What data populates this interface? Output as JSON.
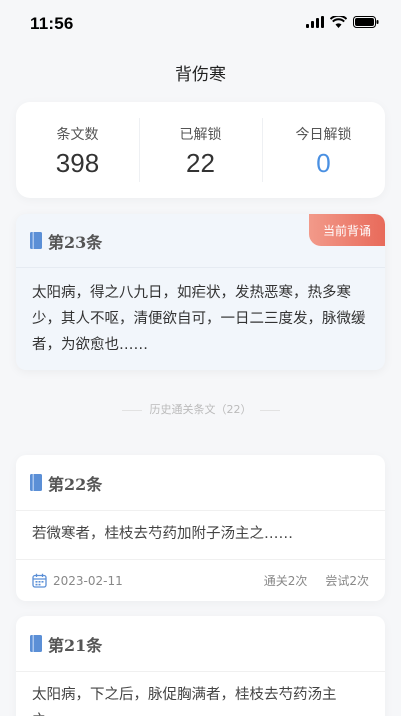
{
  "status": {
    "time": "11:56"
  },
  "page": {
    "title": "背伤寒"
  },
  "stats": [
    {
      "label": "条文数",
      "value": "398"
    },
    {
      "label": "已解锁",
      "value": "22"
    },
    {
      "label": "今日解锁",
      "value": "0"
    }
  ],
  "current": {
    "title": "第23条",
    "badge": "当前背诵",
    "text": "太阳病，得之八九日，如疟状，发热恶寒，热多寒少，其人不呕，清便欲自可，一日二三度发，脉微缓者，为欲愈也……"
  },
  "divider": "历史通关条文（22）",
  "history": [
    {
      "title": "第22条",
      "text": "若微寒者，桂枝去芍药加附子汤主之……",
      "date": "2023-02-11",
      "passes": "通关2次",
      "attempts": "尝试2次"
    },
    {
      "title": "第21条",
      "text": "太阳病，下之后，脉促胸满者，桂枝去芍药汤主之……"
    }
  ],
  "colors": {
    "accent_blue": "#4a90e2",
    "badge_red": "#e86a5a"
  }
}
